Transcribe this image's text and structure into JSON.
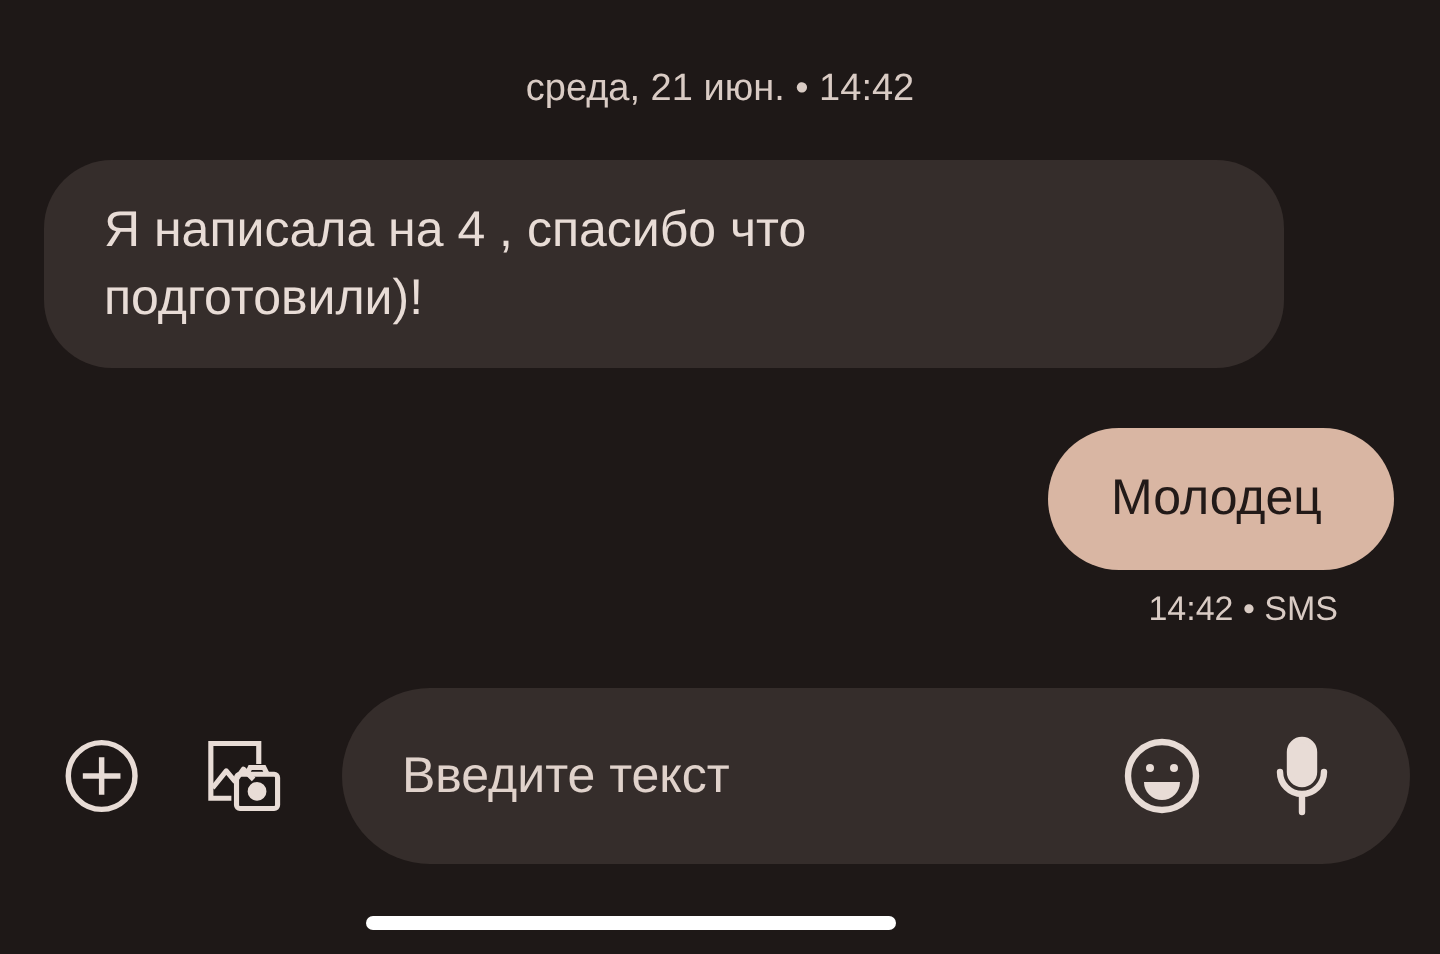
{
  "date_header": "среда, 21 июн. • 14:42",
  "messages": [
    {
      "kind": "incoming",
      "text": "Я написала на 4 , спасибо что подготовили)!"
    },
    {
      "kind": "outgoing",
      "text": "Молодец",
      "meta": "14:42 • SMS"
    }
  ],
  "composer": {
    "placeholder": "Введите текст"
  }
}
